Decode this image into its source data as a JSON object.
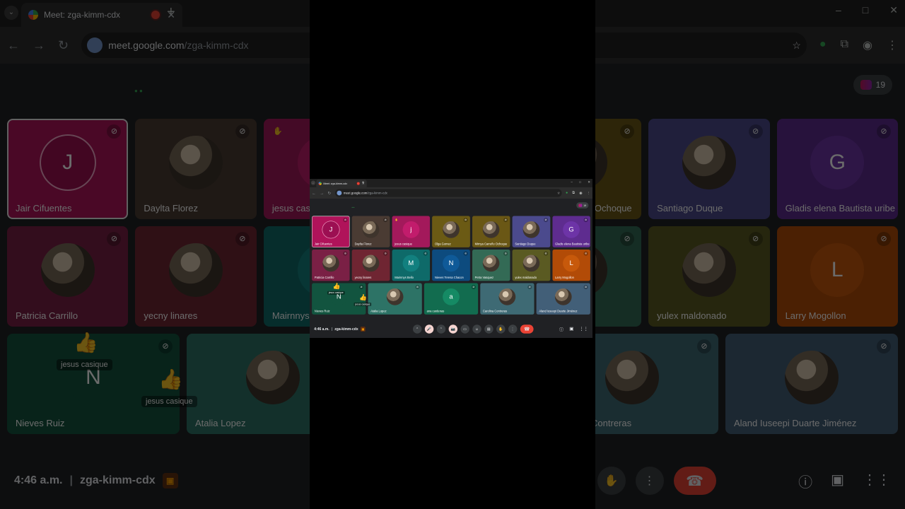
{
  "browser": {
    "tab_title": "Meet: zga-kimm-cdx",
    "tab_search_icon": "chevron-down-icon",
    "new_tab_glyph": "+",
    "url_domain": "meet.google.com",
    "url_path": "/zga-kimm-cdx",
    "window_controls": [
      "–",
      "□",
      "✕"
    ]
  },
  "meet": {
    "participant_count": "19",
    "status_dot": "● ●"
  },
  "tiles": [
    {
      "name": "Jair Cifuentes",
      "initial": "J",
      "color": "#b0135a",
      "avatar": "#9c0f52",
      "selected": true
    },
    {
      "name": "Daylta Florez",
      "initial": "",
      "color": "#4a3b33",
      "avatar": "photo"
    },
    {
      "name": "jesus casique",
      "initial": "j",
      "color": "#a3195b",
      "avatar": "#c21c6c",
      "hand": true
    },
    {
      "name": "Olga Gomez",
      "initial": "",
      "color": "#6b5a14",
      "avatar": "photo"
    },
    {
      "name": "Mirnya Carreño Ochoque",
      "initial": "",
      "color": "#6a5715",
      "avatar": "photo"
    },
    {
      "name": "Santiago Duque",
      "initial": "",
      "color": "#4b4a8d",
      "avatar": "photo"
    },
    {
      "name": "Gladis elena Bautista uribe",
      "initial": "G",
      "color": "#5e2c8f",
      "avatar": "#6d34a7"
    },
    {
      "name": "Patricia Carrillo",
      "initial": "",
      "color": "#7a2045",
      "avatar": "photo"
    },
    {
      "name": "yecny linares",
      "initial": "",
      "color": "#6f2532",
      "avatar": "photo"
    },
    {
      "name": "Mairnnys Bello",
      "initial": "M",
      "color": "#0e6a69",
      "avatar": "#12807f"
    },
    {
      "name": "Nieves Teresa Chacon",
      "initial": "N",
      "color": "#0d4b7e",
      "avatar": "#0f5a98"
    },
    {
      "name": "Petra Vasquez",
      "initial": "",
      "color": "#336a55",
      "avatar": "photo"
    },
    {
      "name": "yulex maldonado",
      "initial": "",
      "color": "#5a5a22",
      "avatar": "photo"
    },
    {
      "name": "Larry Mogollon",
      "initial": "L",
      "color": "#b24b07",
      "avatar": "#c7590b"
    },
    {
      "name": "Nieves Ruiz",
      "initial": "N",
      "color": "#12543f",
      "avatar": "#12543f"
    },
    {
      "name": "Atalia Lopez",
      "initial": "",
      "color": "#2d7366",
      "avatar": "photo"
    },
    {
      "name": "ana cardenas",
      "initial": "a",
      "color": "#126c4f",
      "avatar": "#158a64"
    },
    {
      "name": "Carolina Contreras",
      "initial": "",
      "color": "#3e6a74",
      "avatar": "photo"
    },
    {
      "name": "Aland Iuseepi Duarte Jiménez",
      "initial": "",
      "color": "#425f78",
      "avatar": "photo"
    }
  ],
  "reactions": {
    "emoji": "👍",
    "label_1": "jesus casique",
    "label_2": "jesus casique"
  },
  "bottom": {
    "time": "4:46 a.m.",
    "separator": "|",
    "meeting_code": "zga-kimm-cdx",
    "controls": [
      "⌃",
      "🎤",
      "⌃",
      "📷",
      "▭",
      "☺",
      "▤",
      "✋",
      "⋮"
    ],
    "end_call_icon": "☎",
    "right_icons": [
      "ⓘ",
      "▣",
      "⋮⋮"
    ]
  },
  "colors": {
    "meet_bg": "#202124",
    "accent_red": "#ea4335"
  }
}
